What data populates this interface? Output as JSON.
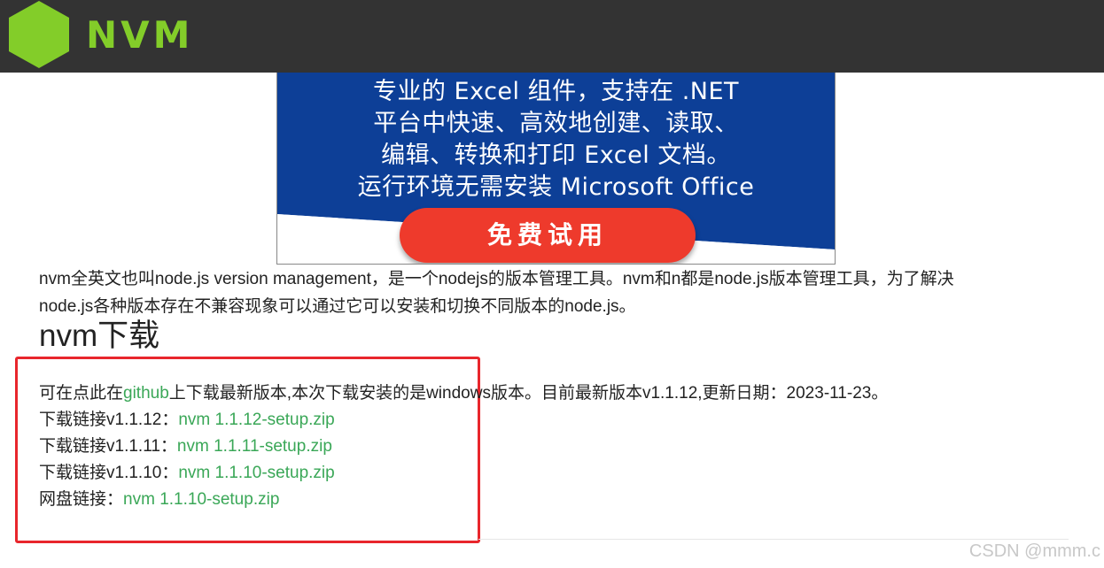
{
  "header": {
    "logo_text": "NVM",
    "logo_color": "#83cd29",
    "bar_color": "#333333"
  },
  "ad": {
    "lines": [
      "专业的 Excel 组件，支持在 .NET",
      "平台中快速、高效地创建、读取、",
      "编辑、转换和打印 Excel 文档。",
      "运行环境无需安装 Microsoft Office"
    ],
    "button_label": "免费试用",
    "bg_color": "#0d3f97",
    "button_color": "#ee3a2c"
  },
  "intro": {
    "line1": "nvm全英文也叫node.js version management，是一个nodejs的版本管理工具。nvm和n都是node.js版本管理工具，为了解决",
    "line2": "node.js各种版本存在不兼容现象可以通过它可以安装和切换不同版本的node.js。"
  },
  "section": {
    "title": "nvm下载",
    "description_prefix": "可在点此在",
    "github_link": "github",
    "description_suffix": "上下载最新版本,本次下载安装的是windows版本。目前最新版本v1.1.12,更新日期：2023-11-23。",
    "downloads": [
      {
        "label": "下载链接v1.1.12：",
        "link": "nvm 1.1.12-setup.zip"
      },
      {
        "label": "下载链接v1.1.11：",
        "link": "nvm 1.1.11-setup.zip"
      },
      {
        "label": "下载链接v1.1.10：",
        "link": "nvm 1.1.10-setup.zip"
      },
      {
        "label": "网盘链接：",
        "link": "nvm 1.1.10-setup.zip"
      }
    ],
    "link_color": "#3aa757",
    "highlight_color": "#e8262c"
  },
  "watermark": "CSDN @mmm.c"
}
